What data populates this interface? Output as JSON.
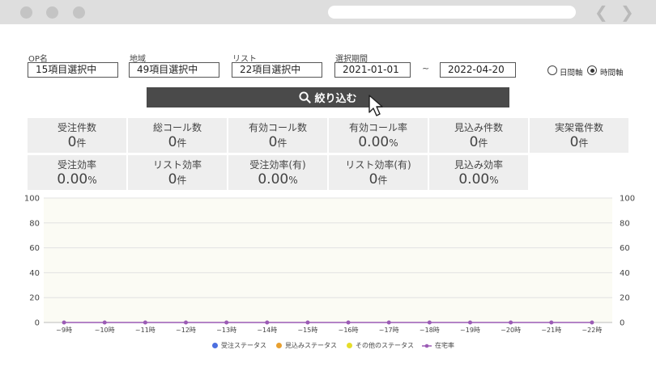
{
  "filters": {
    "op_label": "OP名",
    "op_value": "15項目選択中",
    "region_label": "地域",
    "region_value": "49項目選択中",
    "list_label": "リスト",
    "list_value": "22項目選択中",
    "period_label": "選択期間",
    "period_start": "2021-01-01",
    "period_separator": "~",
    "period_end": "2022-04-20",
    "radio_daily": "日間軸",
    "radio_hourly": "時間軸"
  },
  "search_button": {
    "label": "絞り込む",
    "color": "#4a4a4a"
  },
  "stats": [
    {
      "label": "受注件数",
      "value": "0",
      "unit": "件"
    },
    {
      "label": "総コール数",
      "value": "0",
      "unit": "件"
    },
    {
      "label": "有効コール数",
      "value": "0",
      "unit": "件"
    },
    {
      "label": "有効コール率",
      "value": "0.00",
      "unit": "%"
    },
    {
      "label": "見込み件数",
      "value": "0",
      "unit": "件"
    },
    {
      "label": "実架電件数",
      "value": "0",
      "unit": "件"
    },
    {
      "label": "受注効率",
      "value": "0.00",
      "unit": "%"
    },
    {
      "label": "リスト効率",
      "value": "0",
      "unit": "件"
    },
    {
      "label": "受注効率(有)",
      "value": "0.00",
      "unit": "%"
    },
    {
      "label": "リスト効率(有)",
      "value": "0",
      "unit": "件"
    },
    {
      "label": "見込み効率",
      "value": "0.00",
      "unit": "%"
    }
  ],
  "chart_data": {
    "type": "bar",
    "categories": [
      "~9時",
      "~10時",
      "~11時",
      "~12時",
      "~13時",
      "~14時",
      "~15時",
      "~16時",
      "~17時",
      "~18時",
      "~19時",
      "~20時",
      "~21時",
      "~22時"
    ],
    "ylim": [
      0,
      100
    ],
    "y2lim": [
      0,
      100
    ],
    "yticks": [
      0,
      20,
      40,
      60,
      80,
      100
    ],
    "grid": true,
    "legend_position": "bottom",
    "series": [
      {
        "name": "受注ステータス",
        "type": "bar",
        "color": "#4c6fe0",
        "values": [
          0,
          0,
          0,
          0,
          0,
          0,
          0,
          0,
          0,
          0,
          0,
          0,
          0,
          0
        ]
      },
      {
        "name": "見込みステータス",
        "type": "bar",
        "color": "#e8a030",
        "values": [
          0,
          0,
          0,
          0,
          0,
          0,
          0,
          0,
          0,
          0,
          0,
          0,
          0,
          0
        ]
      },
      {
        "name": "その他のステータス",
        "type": "bar",
        "color": "#e6dd2a",
        "values": [
          0,
          0,
          0,
          0,
          0,
          0,
          0,
          0,
          0,
          0,
          0,
          0,
          0,
          0
        ]
      },
      {
        "name": "在宅率",
        "type": "line",
        "color": "#9b5bb5",
        "values": [
          0,
          0,
          0,
          0,
          0,
          0,
          0,
          0,
          0,
          0,
          0,
          0,
          0,
          0
        ]
      }
    ]
  }
}
